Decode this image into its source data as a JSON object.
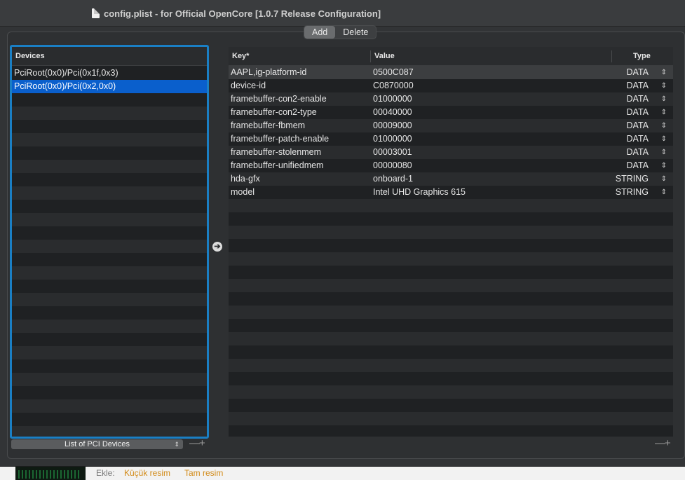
{
  "window": {
    "title": "config.plist - for Official OpenCore [1.0.7 Release Configuration]"
  },
  "toolbar": {
    "add_label": "Add",
    "delete_label": "Delete"
  },
  "devices_panel": {
    "header": "Devices",
    "items": [
      {
        "label": "PciRoot(0x0)/Pci(0x1f,0x3)",
        "selected": false
      },
      {
        "label": "PciRoot(0x0)/Pci(0x2,0x0)",
        "selected": true
      }
    ],
    "footer_select": "List of PCI Devices",
    "minus": "—",
    "plus": "+"
  },
  "properties_table": {
    "columns": {
      "key": "Key*",
      "value": "Value",
      "type": "Type"
    },
    "rows": [
      {
        "key": "AAPL,ig-platform-id",
        "value": "0500C087",
        "type": "DATA"
      },
      {
        "key": "device-id",
        "value": "C0870000",
        "type": "DATA"
      },
      {
        "key": "framebuffer-con2-enable",
        "value": "01000000",
        "type": "DATA"
      },
      {
        "key": "framebuffer-con2-type",
        "value": "00040000",
        "type": "DATA"
      },
      {
        "key": "framebuffer-fbmem",
        "value": "00009000",
        "type": "DATA"
      },
      {
        "key": "framebuffer-patch-enable",
        "value": "01000000",
        "type": "DATA"
      },
      {
        "key": "framebuffer-stolenmem",
        "value": "00003001",
        "type": "DATA"
      },
      {
        "key": "framebuffer-unifiedmem",
        "value": "00000080",
        "type": "DATA"
      },
      {
        "key": "hda-gfx",
        "value": "onboard-1",
        "type": "STRING"
      },
      {
        "key": "model",
        "value": "Intel UHD Graphics 615",
        "type": "STRING"
      }
    ],
    "minus": "—",
    "plus": "+"
  },
  "icons": {
    "document": "document-icon",
    "arrow": "arrow-right-circle-icon",
    "stepper": "stepper-icon",
    "select_chevron": "chevron-updown-icon"
  },
  "page_strip": {
    "ekle": "Ekle:",
    "small_link": "Küçük resim",
    "full_link": "Tam resim"
  },
  "colors": {
    "selection": "#0a5fcc",
    "focus_ring": "#1a7fc4",
    "link": "#d28a17"
  }
}
